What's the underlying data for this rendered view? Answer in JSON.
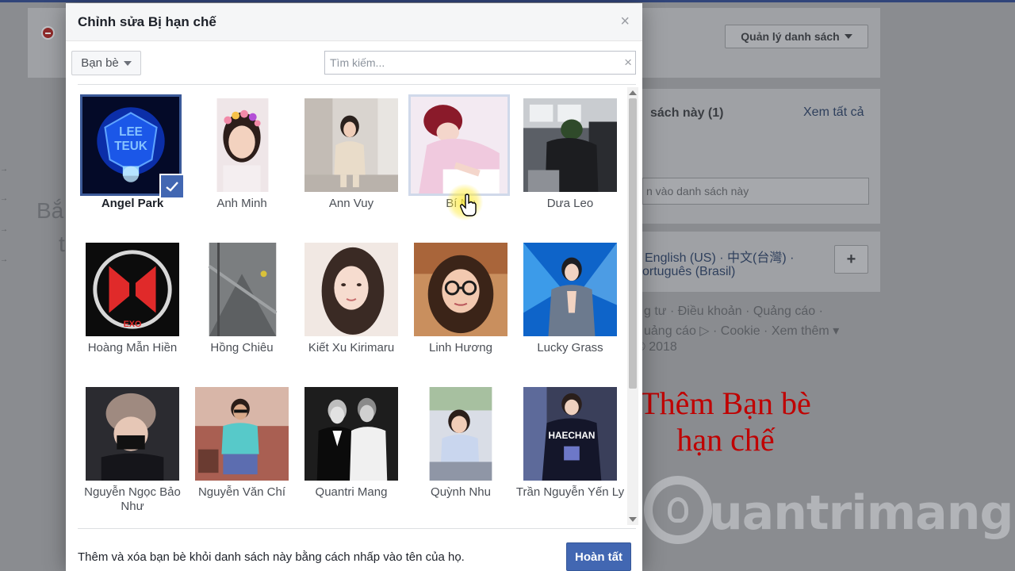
{
  "background": {
    "list_manage_button": "Quản lý danh sách",
    "section_title_partial": "sách này (1)",
    "see_all_link": "Xem tất cả",
    "input_partial": "n vào danh sách này",
    "left_text_1": "Bắ",
    "left_text_2": "t",
    "languages_line1": "English (US) · 中文(台灣) ·",
    "languages_line2": "ortuguês (Brasil)",
    "add_language_button": "+",
    "footer_line1": "g tư · Điều khoản · Quảng cáo ·",
    "footer_line2": "uảng cáo ▷ · Cookie · Xem thêm ▾",
    "footer_line3": "© 2018"
  },
  "overlay_note": {
    "line1": "Thêm Bạn bè",
    "line2": "hạn chế"
  },
  "watermark": {
    "text": "uantrimang"
  },
  "dialog": {
    "title": "Chỉnh sửa Bị hạn chế",
    "close_glyph": "×",
    "filter_button": "Bạn bè",
    "search_placeholder": "Tìm kiếm...",
    "search_value": "",
    "search_clear_glyph": "×",
    "friends": [
      {
        "name": "Angel Park",
        "selected": true,
        "photo": "blue-lightstick-leeteuk"
      },
      {
        "name": "Anh Minh",
        "selected": false,
        "photo": "girl-flower-crown"
      },
      {
        "name": "Ann Vuy",
        "selected": false,
        "photo": "girl-beige-outfit"
      },
      {
        "name": "Bí Nụ",
        "selected": false,
        "hovered": true,
        "photo": "boy-pink-writing"
      },
      {
        "name": "Dưa Leo",
        "selected": false,
        "photo": "person-on-train"
      },
      {
        "name": "Hoàng Mẫn Hiền",
        "selected": false,
        "photo": "exo-red-logo"
      },
      {
        "name": "Hồng Chiêu",
        "selected": false,
        "photo": "grey-street-photo"
      },
      {
        "name": "Kiết Xu Kirimaru",
        "selected": false,
        "photo": "girl-long-hair"
      },
      {
        "name": "Linh Hương",
        "selected": false,
        "photo": "girl-glasses"
      },
      {
        "name": "Lucky Grass",
        "selected": false,
        "photo": "boy-stage-blue"
      },
      {
        "name": "Nguyễn Ngọc Bảo Như",
        "selected": false,
        "photo": "person-beanie-mask"
      },
      {
        "name": "Nguyễn Văn Chí",
        "selected": false,
        "photo": "boy-teal-shirt"
      },
      {
        "name": "Quantri Mang",
        "selected": false,
        "photo": "two-men-bw-suits"
      },
      {
        "name": "Quỳnh Nhu",
        "selected": false,
        "photo": "girl-sitting-cafe"
      },
      {
        "name": "Trần Nguyễn Yến Ly",
        "selected": false,
        "photo": "haechan-jacket"
      }
    ],
    "footer_instruction": "Thêm và xóa bạn bè khỏi danh sách này bằng cách nhấp vào tên của họ.",
    "done_button": "Hoàn tất"
  },
  "colors": {
    "accent": "#4267b2",
    "overlay_note": "#c00000",
    "selected_border": "#3b5998"
  }
}
